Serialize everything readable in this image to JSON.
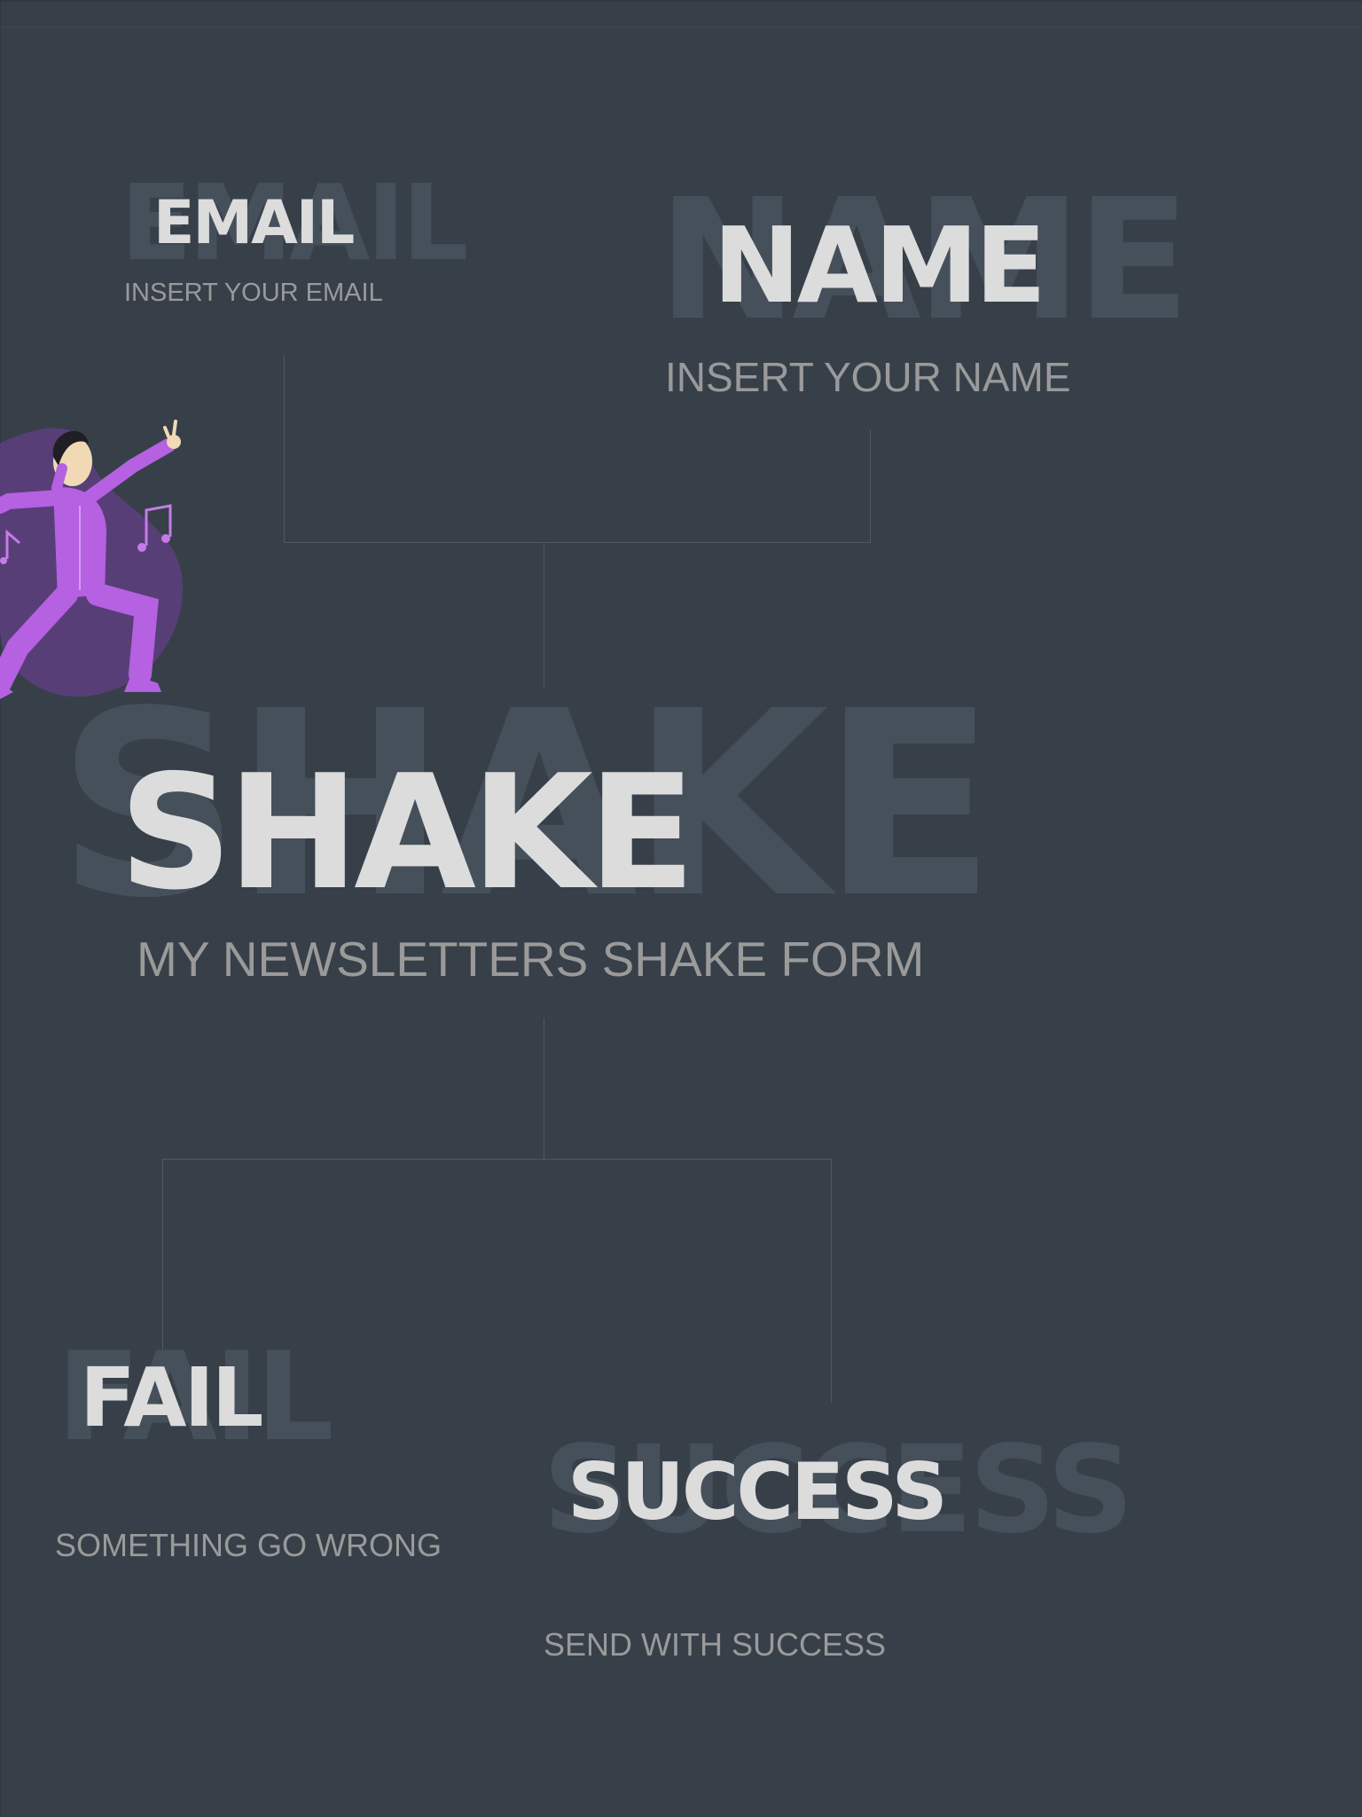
{
  "colors": {
    "background": "#374049",
    "ghost_text": "#46505b",
    "heading_text": "#dcdcdc",
    "subtitle_text": "#9a9a9a",
    "connector_line": "#4f5964",
    "accent_purple": "#b561e2"
  },
  "email": {
    "title": "EMAIL",
    "subtitle": "INSERT YOUR EMAIL"
  },
  "name": {
    "title": "NAME",
    "subtitle": "INSERT YOUR NAME"
  },
  "shake": {
    "title": "SHAKE",
    "subtitle": "MY NEWSLETTERS SHAKE FORM"
  },
  "fail": {
    "title": "FAIL",
    "subtitle": "SOMETHING GO WRONG"
  },
  "success": {
    "title": "SUCCESS",
    "subtitle": "SEND WITH SUCCESS"
  },
  "illustration": "dancing-person-illustration"
}
